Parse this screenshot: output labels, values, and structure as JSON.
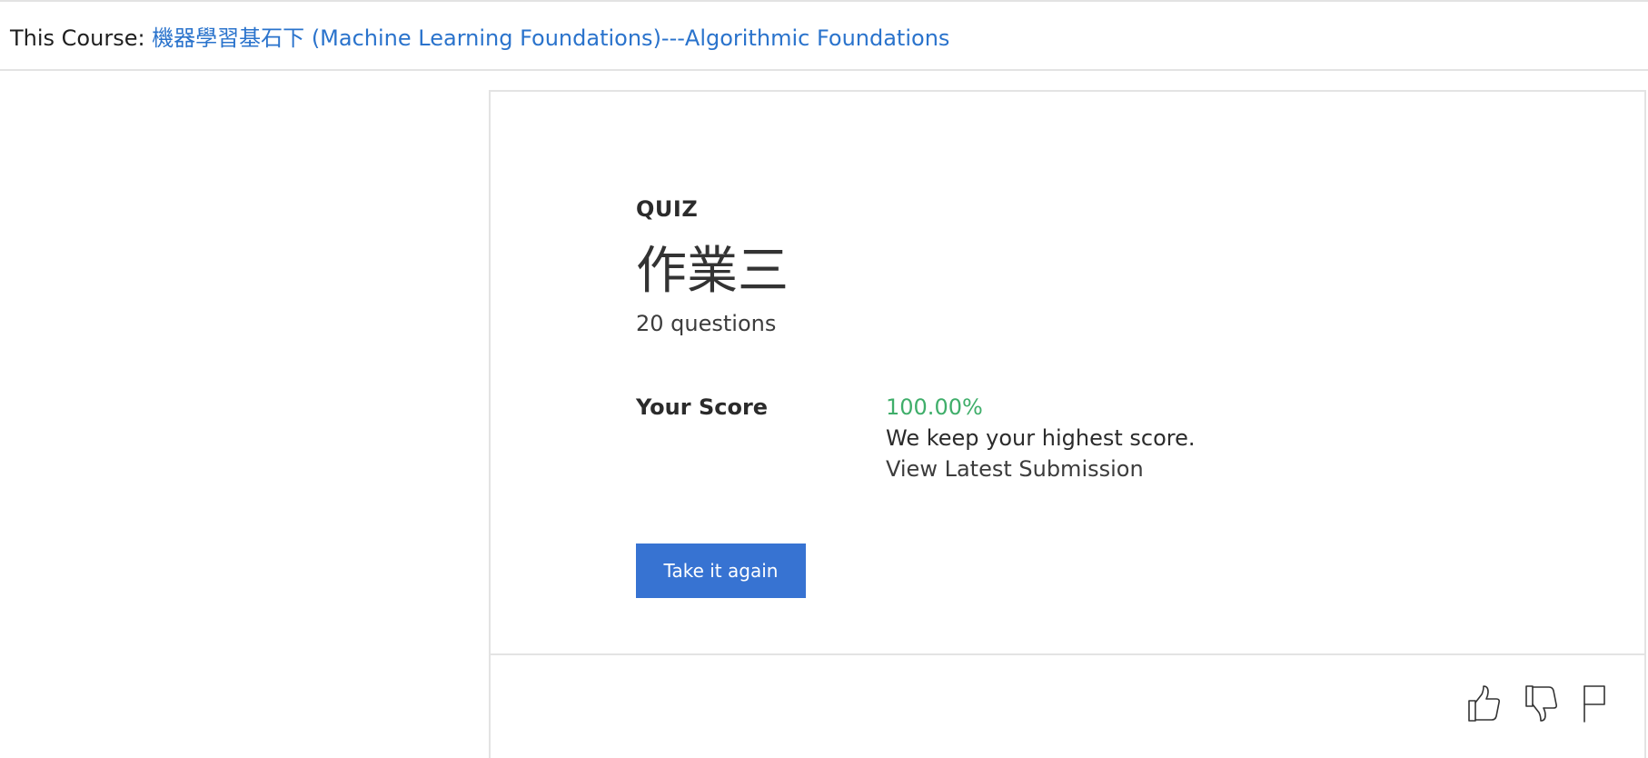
{
  "course": {
    "prefix": "This Course:",
    "link_text": "機器學習基石下 (Machine Learning Foundations)---Algorithmic Foundations"
  },
  "quiz": {
    "label": "QUIZ",
    "title": "作業三",
    "question_count": "20 questions"
  },
  "score": {
    "label": "Your Score",
    "value": "100.00%",
    "note": "We keep your highest score.",
    "view_latest": "View Latest Submission"
  },
  "actions": {
    "retake_label": "Take it again"
  },
  "feedback": {
    "icons": [
      "thumbs-up-icon",
      "thumbs-down-icon",
      "flag-icon"
    ]
  },
  "colors": {
    "link": "#2a73cc",
    "score": "#3fae6a",
    "button": "#3773d2"
  }
}
